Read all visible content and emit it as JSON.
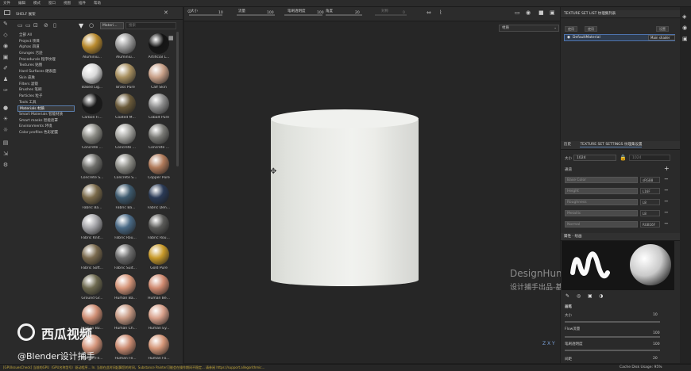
{
  "menubar": [
    "文件",
    "编辑",
    "模式",
    "窗口",
    "视图",
    "插件",
    "帮助"
  ],
  "shelf": {
    "title": "SHELF 展架",
    "search_placeholder": "搜索",
    "filter_tag": "Materi...",
    "categories": [
      {
        "label": "全部 All",
        "selected": false
      },
      {
        "label": "Project 项目",
        "selected": false
      },
      {
        "label": "Alphas 四道",
        "selected": false
      },
      {
        "label": "Grunges 污迹",
        "selected": false
      },
      {
        "label": "Procedurals 程序纹理",
        "selected": false
      },
      {
        "label": "Textures 贴图",
        "selected": false
      },
      {
        "label": "Hard Surfaces 硬表面",
        "selected": false
      },
      {
        "label": "Skin 皮肤",
        "selected": false
      },
      {
        "label": "Filters 滤镜",
        "selected": false
      },
      {
        "label": "Brushes 笔刷",
        "selected": false
      },
      {
        "label": "Particles 粒子",
        "selected": false
      },
      {
        "label": "Tools 工具",
        "selected": false
      },
      {
        "label": "Materials 材质",
        "selected": true
      },
      {
        "label": "Smart Materials 智能材质",
        "selected": false
      },
      {
        "label": "Smart masks 智能遮罩",
        "selected": false
      },
      {
        "label": "Environments 环境",
        "selected": false
      },
      {
        "label": "Color profiles 色彩配置",
        "selected": false
      }
    ],
    "materials": [
      {
        "label": "Aluminiu...",
        "color": "#b88a2e"
      },
      {
        "label": "Aluminiu...",
        "color": "#9b9b9b"
      },
      {
        "label": "Artificial L...",
        "color": "#141414"
      },
      {
        "label": "Baked Lig...",
        "color": "#d9d9d9"
      },
      {
        "label": "Brass Pure",
        "color": "#a89060"
      },
      {
        "label": "Calf Skin",
        "color": "#c8a088"
      },
      {
        "label": "Carbon Fi...",
        "color": "#1a1a1a"
      },
      {
        "label": "Coated M...",
        "color": "#6a5a3a"
      },
      {
        "label": "Cobalt Pure",
        "color": "#8c8c8c"
      },
      {
        "label": "Concrete ...",
        "color": "#8a8a84"
      },
      {
        "label": "Concrete ...",
        "color": "#a6a6a2"
      },
      {
        "label": "Concrete ...",
        "color": "#7a7a76"
      },
      {
        "label": "Concrete S...",
        "color": "#6e6e6a"
      },
      {
        "label": "Concrete S...",
        "color": "#8e8e88"
      },
      {
        "label": "Copper Pure",
        "color": "#b07a5a"
      },
      {
        "label": "Fabric Ba...",
        "color": "#7a6a4a"
      },
      {
        "label": "Fabric Ba...",
        "color": "#3e5a6e"
      },
      {
        "label": "Fabric Den...",
        "color": "#2a3a56"
      },
      {
        "label": "Fabric Knit...",
        "color": "#a6a6aa"
      },
      {
        "label": "Fabric Rou...",
        "color": "#4a6a86"
      },
      {
        "label": "Fabric Rou...",
        "color": "#5a5a58"
      },
      {
        "label": "Fabric Soft...",
        "color": "#7a6a4e"
      },
      {
        "label": "Fabric Suit...",
        "color": "#6e6e6e"
      },
      {
        "label": "Gold Pure",
        "color": "#c89a2a"
      },
      {
        "label": "Ground Gr...",
        "color": "#6e6a50"
      },
      {
        "label": "Human Ba...",
        "color": "#d6967a"
      },
      {
        "label": "Human Be...",
        "color": "#d08a70"
      },
      {
        "label": "Human Bu...",
        "color": "#cf8e74"
      },
      {
        "label": "Human Ch...",
        "color": "#c89a84"
      },
      {
        "label": "Human Ey...",
        "color": "#d8a08a"
      },
      {
        "label": "Human Fe...",
        "color": "#d4947a"
      },
      {
        "label": "Human Fe...",
        "color": "#cc8c72"
      },
      {
        "label": "Human Fo...",
        "color": "#d49678"
      }
    ]
  },
  "viewport": {
    "toolbar": {
      "size_label": "大小",
      "size_value": "10",
      "flow_label": "流量",
      "flow_value": "100",
      "opacity_label": "笔刷透明度",
      "opacity_value": "100",
      "angle_label": "角度",
      "angle_value": "20",
      "spacing_label": "对称",
      "spacing_value": "0"
    },
    "view_mode": "材质",
    "watermark": "DesignHunting",
    "watermark_cn": "设计捕手出品-基础部分",
    "axis_label": "Z X Y"
  },
  "texture_set_list": {
    "title": "TEXTURE SET LIST 纹理集列表",
    "btn_1": "使用",
    "btn_2": "使用",
    "settings_label": "设置",
    "item_label": "DefaultMaterial",
    "item_shader": "Main shader"
  },
  "texture_set_settings": {
    "tab_history": "历史",
    "tab_title": "TEXTURE SET SETTINGS 纹理集设置",
    "size_label": "大小",
    "size_value": "1024",
    "size_value_2": "1024",
    "channels_label": "通道",
    "channels": [
      {
        "name": "Base Color",
        "format": "sRGB8"
      },
      {
        "name": "Height",
        "format": "L16F"
      },
      {
        "name": "Roughness",
        "format": "L8"
      },
      {
        "name": "Metallic",
        "format": "L8"
      },
      {
        "name": "Normal",
        "format": "RGB16F"
      }
    ]
  },
  "properties": {
    "title": "属性 - 绘画",
    "section": "画笔",
    "size_label": "大小",
    "size_value": "10",
    "flow_label": "Flow流量",
    "flow_value": "100",
    "opacity_label": "笔刷透明度",
    "opacity_value": "100",
    "spacing_label": "间距",
    "spacing_value": "20"
  },
  "statusbar": {
    "message": "[GPUIssuesCheck] 当前的GPU（GPU名称型号）驱动程序... In. 当前在此时间起算您的时间，Substance Painter可能会在操作期间不稳定... 请参阅 https://support.allegorithmic...",
    "cache": "Cache Disk Usage: 95%"
  },
  "overlay": {
    "logo_text": "西瓜视频",
    "handle": "@Blender设计捕手"
  }
}
